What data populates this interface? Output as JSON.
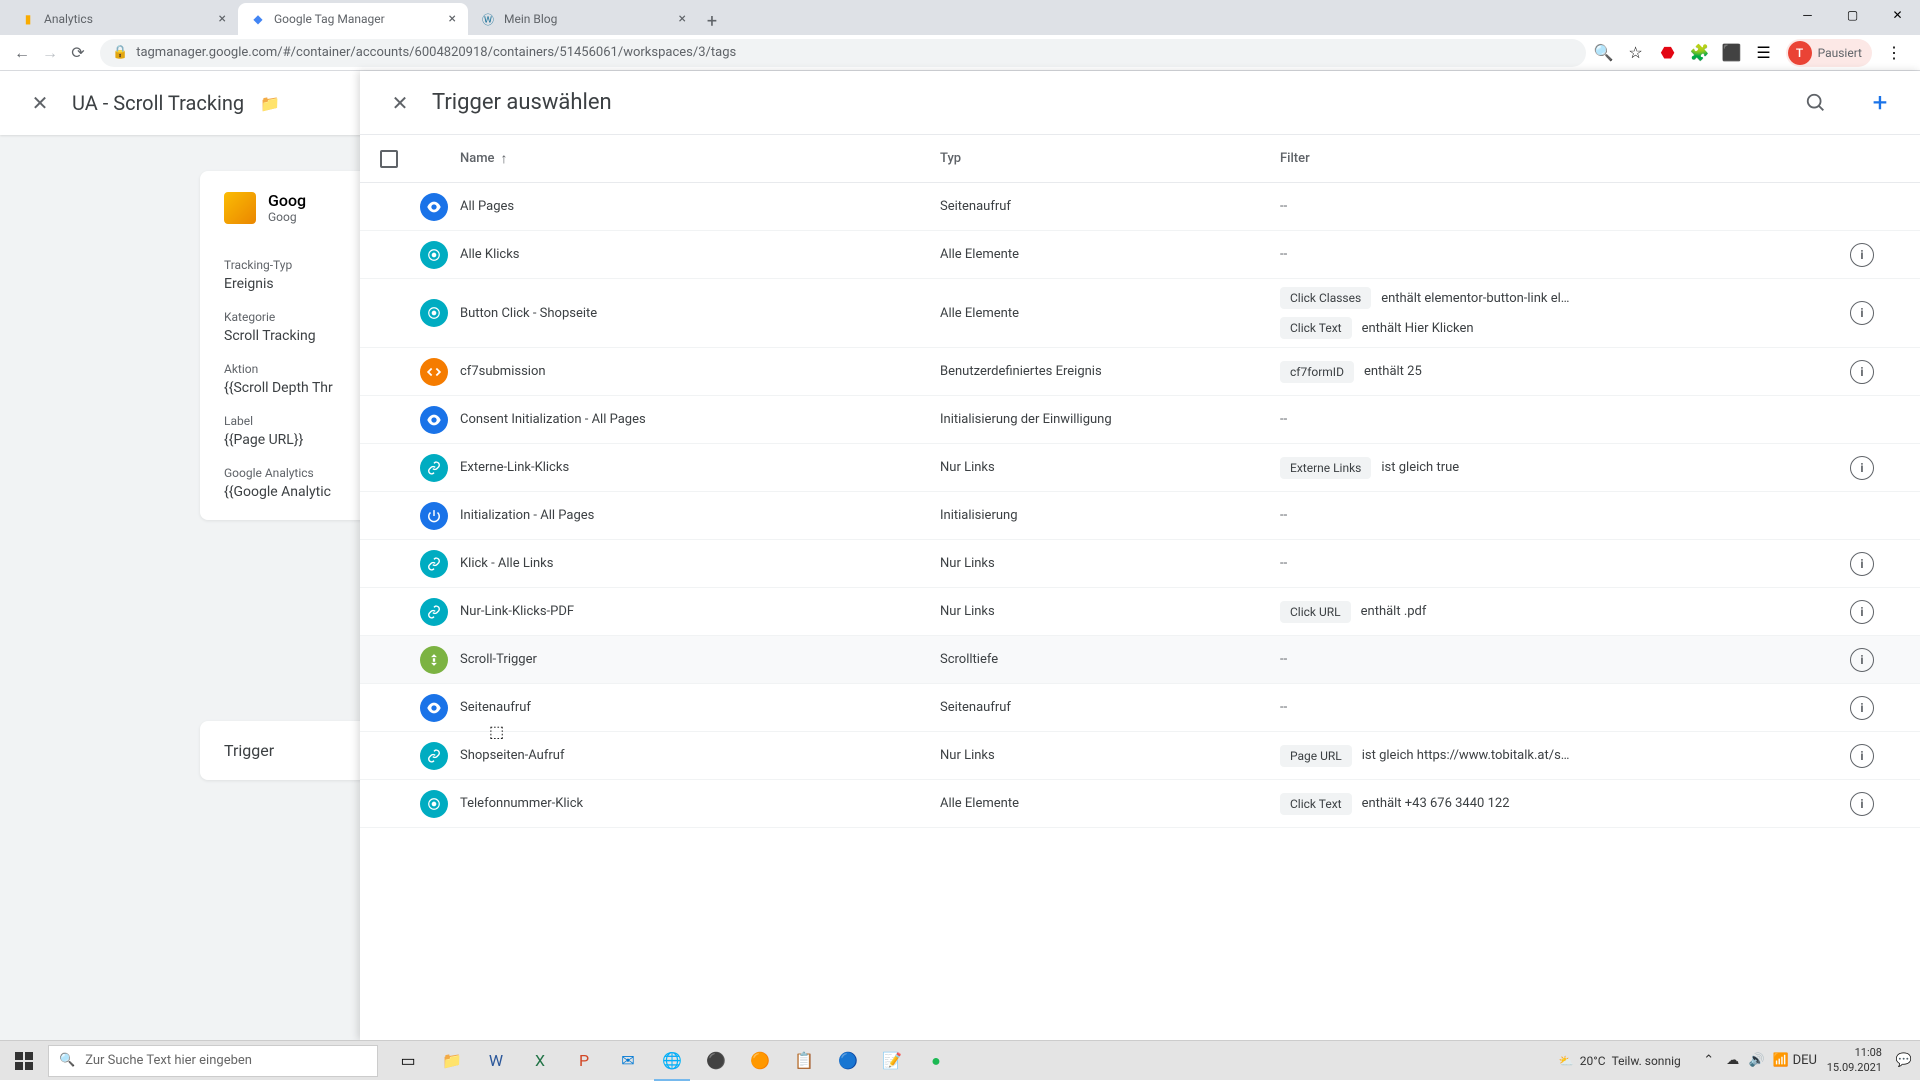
{
  "browser": {
    "tabs": [
      {
        "title": "Analytics",
        "favicon": "📊"
      },
      {
        "title": "Google Tag Manager",
        "favicon": "◆",
        "active": true
      },
      {
        "title": "Mein Blog",
        "favicon": "Ⓦ"
      }
    ],
    "url": "tagmanager.google.com/#/container/accounts/6004820918/containers/51456061/workspaces/3/tags",
    "profile_status": "Pausiert",
    "profile_initial": "T"
  },
  "editor": {
    "tag_title": "UA - Scroll Tracking",
    "config_title": "Goog",
    "config_subtitle": "Goog",
    "fields": {
      "tracking_type_label": "Tracking-Typ",
      "tracking_type_value": "Ereignis",
      "category_label": "Kategorie",
      "category_value": "Scroll Tracking",
      "action_label": "Aktion",
      "action_value": "{{Scroll Depth Thr",
      "label_label": "Label",
      "label_value": "{{Page URL}}",
      "ga_label": "Google Analytics",
      "ga_value": "{{Google Analytic"
    },
    "trigger_section": "Trigger"
  },
  "trigger_panel": {
    "title": "Trigger auswählen",
    "columns": {
      "name": "Name",
      "type": "Typ",
      "filter": "Filter"
    },
    "rows": [
      {
        "icon": "eye",
        "color": "blue",
        "name": "All Pages",
        "type": "Seitenaufruf",
        "filter": "--",
        "info": false
      },
      {
        "icon": "click",
        "color": "teal",
        "name": "Alle Klicks",
        "type": "Alle Elemente",
        "filter": "--",
        "info": true
      },
      {
        "icon": "click",
        "color": "teal",
        "name": "Button Click - Shopseite",
        "type": "Alle Elemente",
        "filters": [
          {
            "chip": "Click Classes",
            "text": "enthält elementor-button-link el…"
          },
          {
            "chip": "Click Text",
            "text": "enthält Hier Klicken"
          }
        ],
        "info": true
      },
      {
        "icon": "code",
        "color": "orange",
        "name": "cf7submission",
        "type": "Benutzerdefiniertes Ereignis",
        "filters": [
          {
            "chip": "cf7formID",
            "text": "enthält 25"
          }
        ],
        "info": true
      },
      {
        "icon": "eye",
        "color": "blue",
        "name": "Consent Initialization - All Pages",
        "type": "Initialisierung der Einwilligung",
        "filter": "--",
        "info": false
      },
      {
        "icon": "link",
        "color": "teal",
        "name": "Externe-Link-Klicks",
        "type": "Nur Links",
        "filters": [
          {
            "chip": "Externe Links",
            "text": "ist gleich true"
          }
        ],
        "info": true
      },
      {
        "icon": "power",
        "color": "blue",
        "name": "Initialization - All Pages",
        "type": "Initialisierung",
        "filter": "--",
        "info": false
      },
      {
        "icon": "link",
        "color": "teal",
        "name": "Klick - Alle Links",
        "type": "Nur Links",
        "filter": "--",
        "info": true
      },
      {
        "icon": "link",
        "color": "teal",
        "name": "Nur-Link-Klicks-PDF",
        "type": "Nur Links",
        "filters": [
          {
            "chip": "Click URL",
            "text": "enthält .pdf"
          }
        ],
        "info": true
      },
      {
        "icon": "scroll",
        "color": "green",
        "name": "Scroll-Trigger",
        "type": "Scrolltiefe",
        "filter": "--",
        "info": true,
        "hovered": true
      },
      {
        "icon": "eye",
        "color": "blue",
        "name": "Seitenaufruf",
        "type": "Seitenaufruf",
        "filter": "--",
        "info": true
      },
      {
        "icon": "link",
        "color": "teal",
        "name": "Shopseiten-Aufruf",
        "type": "Nur Links",
        "filters": [
          {
            "chip": "Page URL",
            "text": "ist gleich https://www.tobitalk.at/s…"
          }
        ],
        "info": true
      },
      {
        "icon": "click",
        "color": "teal",
        "name": "Telefonnummer-Klick",
        "type": "Alle Elemente",
        "filters": [
          {
            "chip": "Click Text",
            "text": "enthält +43 676 3440 122"
          }
        ],
        "info": true
      }
    ]
  },
  "taskbar": {
    "search_placeholder": "Zur Suche Text hier eingeben",
    "weather_temp": "20°C",
    "weather_text": "Teilw. sonnig",
    "lang": "DEU",
    "time": "11:08",
    "date": "15.09.2021"
  }
}
